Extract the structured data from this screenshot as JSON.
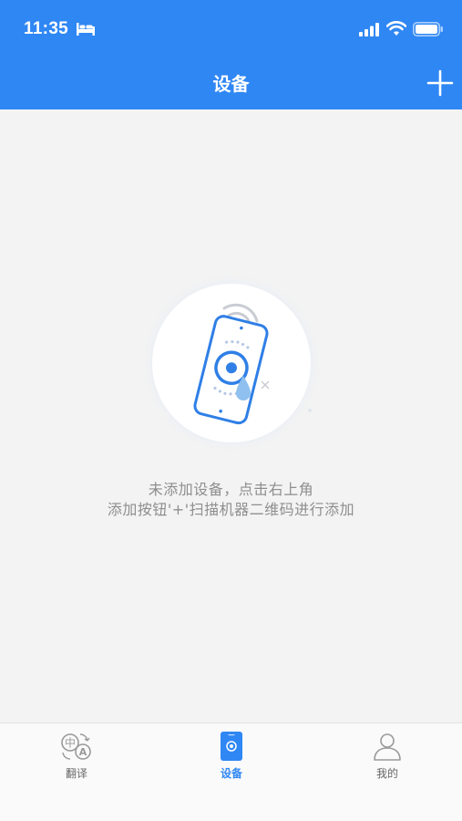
{
  "status_bar": {
    "time": "11:35"
  },
  "header": {
    "title": "设备",
    "add_icon": "plus-icon"
  },
  "empty_state": {
    "line1": "未添加设备，点击右上角",
    "line2": "添加按钮'+'扫描机器二维码进行添加",
    "illustration_icon": "phone-device-icon"
  },
  "tabbar": {
    "tabs": [
      {
        "label": "翻译",
        "icon": "translate-icon",
        "active": false
      },
      {
        "label": "设备",
        "icon": "device-icon",
        "active": true
      },
      {
        "label": "我的",
        "icon": "profile-icon",
        "active": false
      }
    ]
  },
  "colors": {
    "primary": "#2f87f4",
    "background": "#f3f3f3",
    "text_muted": "#8e8e8e"
  }
}
